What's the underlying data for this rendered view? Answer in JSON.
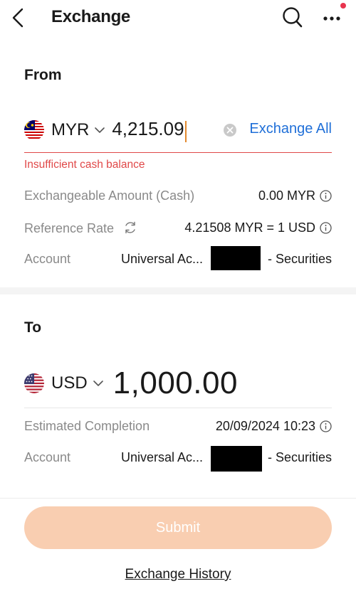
{
  "colors": {
    "accent_blue": "#1f6fd8",
    "error_red": "#e04848",
    "submit_disabled": "#f9ceb1",
    "notify_dot": "#e8344e"
  },
  "header": {
    "title": "Exchange",
    "back_icon": "chevron-left-icon",
    "search_icon": "search-icon",
    "more_icon": "more-horizontal-icon"
  },
  "from": {
    "section_title": "From",
    "currency_code": "MYR",
    "flag_icon": "malaysia-flag-icon",
    "amount_input": "4,215.09",
    "exchange_all_label": "Exchange All",
    "error_message": "Insufficient cash balance",
    "exchangeable_label": "Exchangeable Amount (Cash)",
    "exchangeable_value": "0.00 MYR",
    "rate_label": "Reference Rate",
    "rate_value": "4.21508 MYR = 1 USD",
    "account_label": "Account",
    "account_name": "Universal Ac...",
    "account_suffix": "- Securities"
  },
  "to": {
    "section_title": "To",
    "currency_code": "USD",
    "flag_icon": "us-flag-icon",
    "amount": "1,000.00",
    "completion_label": "Estimated Completion",
    "completion_value": "20/09/2024 10:23",
    "account_label": "Account",
    "account_name": "Universal Ac...",
    "account_suffix": "- Securities"
  },
  "footer": {
    "submit_label": "Submit",
    "history_label": "Exchange History"
  }
}
